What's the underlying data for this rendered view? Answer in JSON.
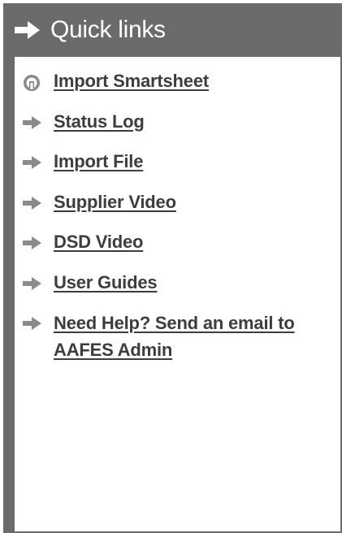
{
  "header": {
    "title": "Quick links",
    "icon": "arrow-right-icon"
  },
  "links": [
    {
      "label": "Import Smartsheet",
      "icon": "gauge-icon"
    },
    {
      "label": "Status Log",
      "icon": "arrow-right-icon"
    },
    {
      "label": "Import File",
      "icon": "arrow-right-icon"
    },
    {
      "label": "Supplier Video",
      "icon": "arrow-right-icon"
    },
    {
      "label": "DSD Video",
      "icon": "arrow-right-icon"
    },
    {
      "label": "User Guides",
      "icon": "arrow-right-icon"
    },
    {
      "label": "Need Help? Send an email to AAFES Admin",
      "icon": "arrow-right-icon"
    }
  ],
  "colors": {
    "header_bg": "#6b6b6b",
    "header_text": "#ffffff",
    "link_text": "#3d3d3d",
    "icon_gray": "#8a8a8a"
  }
}
